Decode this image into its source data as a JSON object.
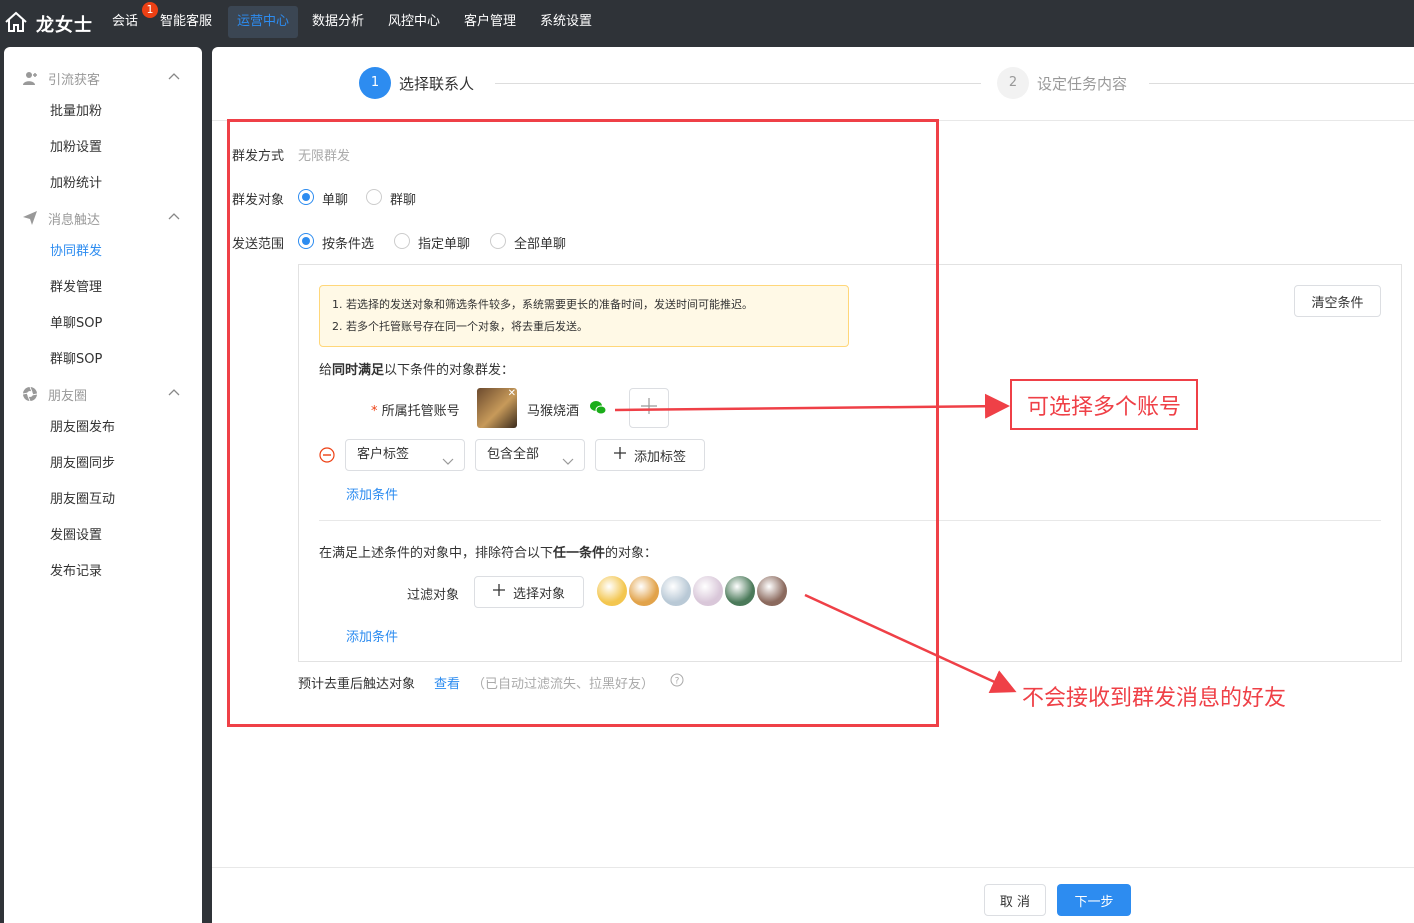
{
  "brand": {
    "name": "龙女士",
    "icon": "home-icon"
  },
  "nav": {
    "items": [
      {
        "label": "会话",
        "badge": "1"
      },
      {
        "label": "智能客服"
      },
      {
        "label": "运营中心",
        "active": true
      },
      {
        "label": "数据分析"
      },
      {
        "label": "风控中心"
      },
      {
        "label": "客户管理"
      },
      {
        "label": "系统设置"
      }
    ]
  },
  "sidebar": {
    "groups": [
      {
        "title": "引流获客",
        "icon": "user-add-icon",
        "items": [
          "批量加粉",
          "加粉设置",
          "加粉统计"
        ]
      },
      {
        "title": "消息触达",
        "icon": "paper-plane-icon",
        "items": [
          "协同群发",
          "群发管理",
          "单聊SOP",
          "群聊SOP"
        ],
        "active_item": "协同群发"
      },
      {
        "title": "朋友圈",
        "icon": "shutter-icon",
        "items": [
          "朋友圈发布",
          "朋友圈同步",
          "朋友圈互动",
          "发圈设置",
          "发布记录"
        ]
      }
    ]
  },
  "steps": [
    {
      "number": "1",
      "label": "选择联系人",
      "active": true
    },
    {
      "number": "2",
      "label": "设定任务内容",
      "active": false
    }
  ],
  "form": {
    "mode_label": "群发方式",
    "mode_value": "无限群发",
    "target_label": "群发对象",
    "target_options": [
      "单聊",
      "群聊"
    ],
    "target_selected": "单聊",
    "scope_label": "发送范围",
    "scope_options": [
      "按条件选",
      "指定单聊",
      "全部单聊"
    ],
    "scope_selected": "按条件选"
  },
  "conditions": {
    "notice_lines": [
      "1. 若选择的发送对象和筛选条件较多，系统需要更长的准备时间，发送时间可能推迟。",
      "2. 若多个托管账号存在同一个对象，将去重后发送。"
    ],
    "clear_button": "清空条件",
    "include_heading_pre": "给",
    "include_heading_bold": "同时满足",
    "include_heading_post": "以下条件的对象群发：",
    "account_required": "*",
    "account_label": "所属托管账号",
    "account_name": "马猴烧酒",
    "tag_select": "客户标签",
    "match_select": "包含全部",
    "add_tag_button": "添加标签",
    "add_condition": "添加条件",
    "exclude_heading_pre": "在满足上述条件的对象中，排除符合以下",
    "exclude_heading_bold": "任一条件",
    "exclude_heading_post": "的对象：",
    "filter_label": "过滤对象",
    "select_target_button": "选择对象",
    "add_condition_2": "添加条件",
    "avatar_colors": [
      "#f3c64f",
      "#e2a34a",
      "#b9c9d6",
      "#d9c7d9",
      "#4b7a5a",
      "#8b6a5e"
    ]
  },
  "estimate": {
    "label": "预计去重后触达对象",
    "link": "查看",
    "note": "（已自动过滤流失、拉黑好友）"
  },
  "footer": {
    "cancel": "取 消",
    "next": "下一步"
  },
  "annotations": {
    "callout_accounts": "可选择多个账号",
    "callout_friends": "不会接收到群发消息的好友",
    "color": "#ef4047"
  }
}
